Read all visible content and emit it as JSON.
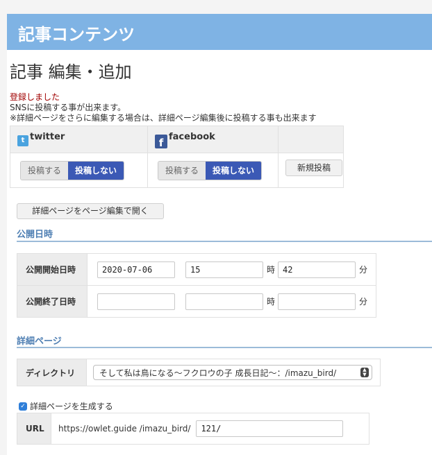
{
  "header": {
    "title": "記事コンテンツ"
  },
  "page": {
    "title": "記事 編集・追加"
  },
  "notice": {
    "status": "登録しました",
    "line1": "SNSに投稿する事が出来ます。",
    "line2": "※詳細ページをさらに編集する場合は、詳細ページ編集後に投稿する事も出来ます"
  },
  "sns": {
    "twitter": {
      "name": "twitter",
      "post_label": "投稿する",
      "nopost_label": "投稿しない",
      "icon": "twitter-icon"
    },
    "facebook": {
      "name": "facebook",
      "post_label": "投稿する",
      "nopost_label": "投稿しない",
      "icon": "facebook-icon"
    },
    "new_post_label": "新規投稿"
  },
  "detail_button_label": "詳細ページをページ編集で開く",
  "publish": {
    "section_title": "公開日時",
    "start_label": "公開開始日時",
    "end_label": "公開終了日時",
    "start_date": "2020-07-06",
    "start_hour": "15",
    "start_minute": "42",
    "end_date": "",
    "end_hour": "",
    "end_minute": "",
    "hour_unit": "時",
    "minute_unit": "分"
  },
  "detail": {
    "section_title": "詳細ページ",
    "directory_label": "ディレクトリ",
    "directory_value": "そして私は鳥になる〜フクロウの子 成長日記〜：/imazu_bird/",
    "generate_label": "詳細ページを生成する",
    "generate_checked": true,
    "url_label": "URL",
    "url_prefix": "https://owlet.guide /imazu_bird/",
    "url_value": "121/"
  },
  "colors": {
    "header": "#7fb3e4",
    "accent": "#3b59b5",
    "status": "#a00000",
    "section": "#4f7fb3"
  }
}
